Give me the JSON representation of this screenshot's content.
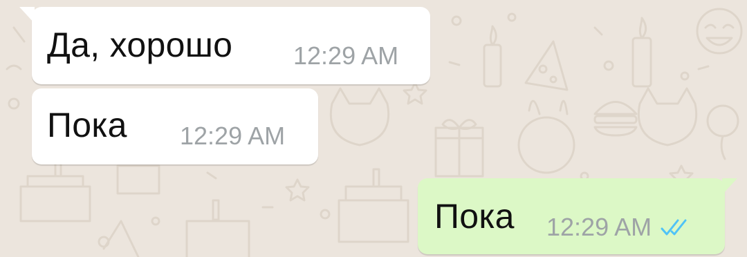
{
  "conversation": {
    "messages": [
      {
        "direction": "incoming",
        "text": "Да, хорошо",
        "time": "12:29 AM"
      },
      {
        "direction": "incoming",
        "text": "Пока",
        "time": "12:29 AM"
      },
      {
        "direction": "outgoing",
        "text": "Пока",
        "time": "12:29 AM",
        "status_icon": "double-check-read-icon"
      }
    ]
  },
  "colors": {
    "background": "#ece5dd",
    "incoming_bubble": "#ffffff",
    "outgoing_bubble": "#dcf8c6",
    "time_text": "#9ea3a6",
    "read_ticks": "#4fc3f7"
  }
}
